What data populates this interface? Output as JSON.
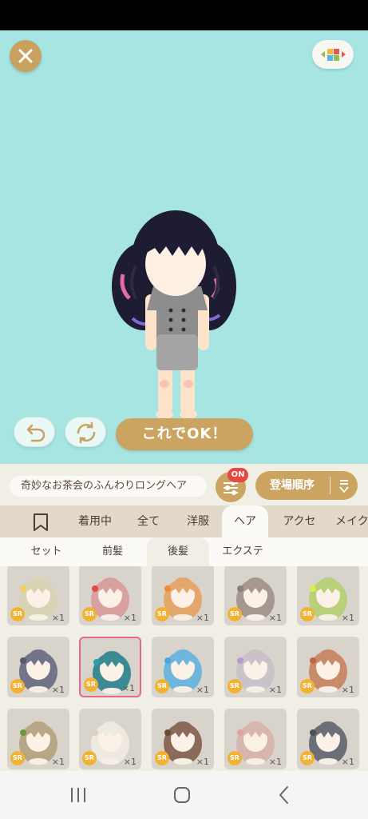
{
  "preview": {
    "ok_button_label": "これでOK！",
    "close_icon": "close-icon",
    "palette_icon": "palette-icon",
    "undo_icon": "undo-icon",
    "rotate_icon": "rotate-icon"
  },
  "panel": {
    "selected_item_name": "奇妙なお茶会のふんわりロングヘア",
    "filter_badge": "ON",
    "sort_label": "登場順序",
    "tabs": [
      {
        "label": "着用中"
      },
      {
        "label": "全て"
      },
      {
        "label": "洋服"
      },
      {
        "label": "ヘア",
        "active": true
      },
      {
        "label": "アクセ"
      },
      {
        "label": "メイク"
      }
    ],
    "subtabs": [
      {
        "label": "セット"
      },
      {
        "label": "前髪"
      },
      {
        "label": "後髪",
        "active": true
      },
      {
        "label": "エクステ"
      }
    ],
    "items": [
      {
        "rarity": "SR",
        "count": "×1",
        "hair_color": "#d9d3b6",
        "accent": "#f4cf5a"
      },
      {
        "rarity": "SR",
        "count": "×1",
        "hair_color": "#d9a0a0",
        "accent": "#e04848"
      },
      {
        "rarity": "SR",
        "count": "×1",
        "hair_color": "#e3a76b",
        "accent": "#f08a3a"
      },
      {
        "rarity": "SR",
        "count": "×1",
        "hair_color": "#a59890",
        "accent": "#8a7f7a"
      },
      {
        "rarity": "SR",
        "count": "×1",
        "hair_color": "#b8d07a",
        "accent": "#d8f040"
      },
      {
        "rarity": "SR",
        "count": "×1",
        "hair_color": "#727588",
        "accent": "#55586a"
      },
      {
        "rarity": "SR",
        "count": "×1",
        "hair_color": "#3c8a94",
        "accent": "#2f9aa8",
        "selected": true
      },
      {
        "rarity": "SR",
        "count": "×1",
        "hair_color": "#6fb6dc",
        "accent": "#4aa6e0"
      },
      {
        "rarity": "SR",
        "count": "×1",
        "hair_color": "#c9c2c8",
        "accent": "#b79ad6"
      },
      {
        "rarity": "SR",
        "count": "×1",
        "hair_color": "#c98a6a",
        "accent": "#c0643e"
      },
      {
        "rarity": "SR",
        "count": "×1",
        "hair_color": "#b7a784",
        "accent": "#6b9a3a"
      },
      {
        "rarity": "SR",
        "count": "×1",
        "hair_color": "#eeeae2",
        "accent": "#d8d2c6"
      },
      {
        "rarity": "SR",
        "count": "×1",
        "hair_color": "#8a6a58",
        "accent": "#6a4a3a"
      },
      {
        "rarity": "SR",
        "count": "×1",
        "hair_color": "#d8b6b0",
        "accent": "#e2a2a0"
      },
      {
        "rarity": "SR",
        "count": "×1",
        "hair_color": "#6d6f78",
        "accent": "#4e5058"
      }
    ]
  },
  "colors": {
    "stage_bg": "#a6e5e2",
    "gold": "#caa460",
    "badge_red": "#e8463f",
    "sr_badge": "#f2b233"
  }
}
